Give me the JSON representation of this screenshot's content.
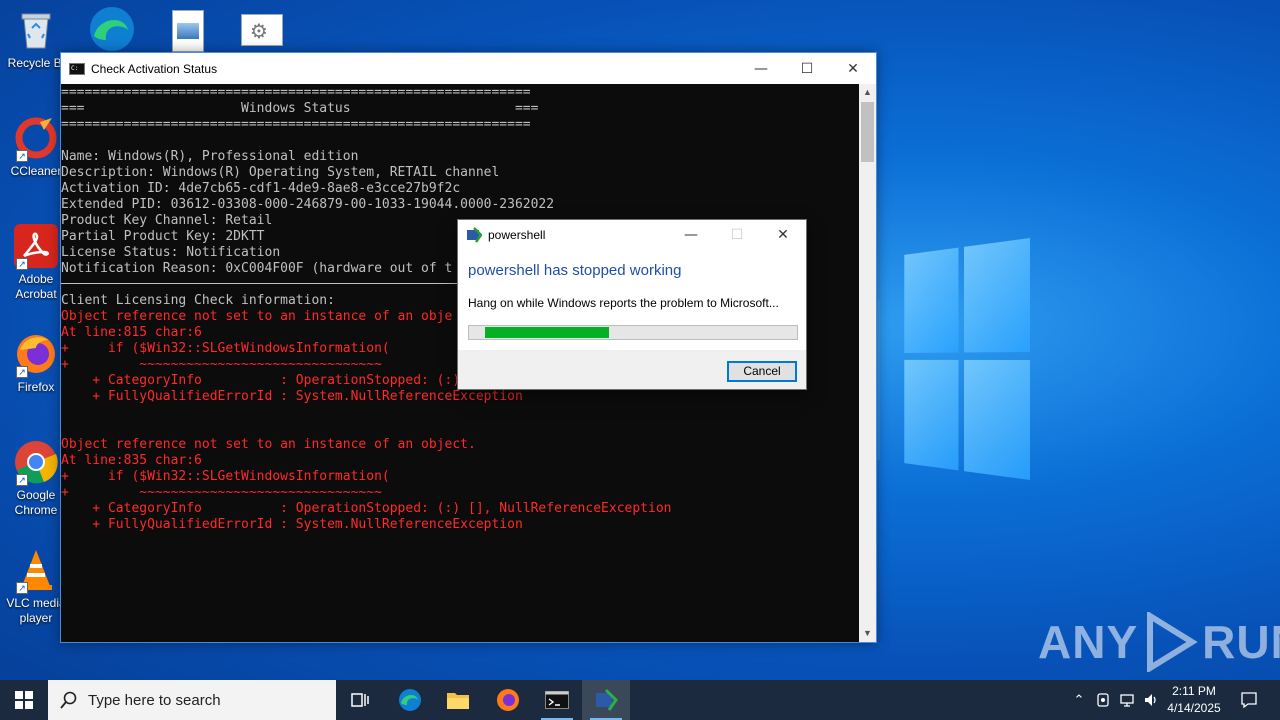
{
  "desktop": {
    "icons": [
      {
        "label": "Recycle Bi",
        "icon": "recycle-bin-icon"
      },
      {
        "label": "CCleaner",
        "icon": "ccleaner-icon"
      },
      {
        "label": "Adobe Acrobat",
        "icon": "adobe-acrobat-icon"
      },
      {
        "label": "Firefox",
        "icon": "firefox-icon"
      },
      {
        "label": "Google Chrome",
        "icon": "chrome-icon"
      },
      {
        "label": "VLC media player",
        "icon": "vlc-icon"
      }
    ],
    "top_icons": [
      "edge-icon",
      "image-file-icon",
      "settings-file-icon"
    ]
  },
  "console": {
    "title": "Check Activation Status",
    "lines": [
      {
        "text": "============================================================",
        "err": false
      },
      {
        "text": "===                    Windows Status                     ===",
        "err": false
      },
      {
        "text": "============================================================",
        "err": false
      },
      {
        "text": "",
        "err": false
      },
      {
        "text": "Name: Windows(R), Professional edition",
        "err": false
      },
      {
        "text": "Description: Windows(R) Operating System, RETAIL channel",
        "err": false
      },
      {
        "text": "Activation ID: 4de7cb65-cdf1-4de9-8ae8-e3cce27b9f2c",
        "err": false
      },
      {
        "text": "Extended PID: 03612-03308-000-246879-00-1033-19044.0000-2362022",
        "err": false
      },
      {
        "text": "Product Key Channel: Retail",
        "err": false
      },
      {
        "text": "Partial Product Key: 2DKTT",
        "err": false
      },
      {
        "text": "License Status: Notification",
        "err": false
      },
      {
        "text": "Notification Reason: 0xC004F00F (hardware out of t",
        "err": false
      },
      {
        "text": "",
        "err": false
      },
      {
        "text": "Client Licensing Check information:",
        "err": false
      },
      {
        "text": "Object reference not set to an instance of an obje",
        "err": true
      },
      {
        "text": "At line:815 char:6",
        "err": true
      },
      {
        "text": "+     if ($Win32::SLGetWindowsInformation(",
        "err": true
      },
      {
        "text": "+         ~~~~~~~~~~~~~~~~~~~~~~~~~~~~~~~",
        "err": true
      },
      {
        "text": "    + CategoryInfo          : OperationStopped: (:) [], NullReferenceException",
        "err": true
      },
      {
        "text": "    + FullyQualifiedErrorId : System.NullReferenceException",
        "err": true
      },
      {
        "text": "",
        "err": false
      },
      {
        "text": "",
        "err": false
      },
      {
        "text": "Object reference not set to an instance of an object.",
        "err": true
      },
      {
        "text": "At line:835 char:6",
        "err": true
      },
      {
        "text": "+     if ($Win32::SLGetWindowsInformation(",
        "err": true
      },
      {
        "text": "+         ~~~~~~~~~~~~~~~~~~~~~~~~~~~~~~~",
        "err": true
      },
      {
        "text": "    + CategoryInfo          : OperationStopped: (:) [], NullReferenceException",
        "err": true
      },
      {
        "text": "    + FullyQualifiedErrorId : System.NullReferenceException",
        "err": true
      }
    ]
  },
  "dialog": {
    "title": "powershell",
    "heading": "powershell has stopped working",
    "message": "Hang on while Windows reports the problem to Microsoft...",
    "progress_fraction": 0.42,
    "cancel_label": "Cancel"
  },
  "watermark": {
    "left": "ANY",
    "right": "RUN"
  },
  "taskbar": {
    "search_placeholder": "Type here to search",
    "apps": [
      "task-view-icon",
      "edge-icon",
      "file-explorer-icon",
      "firefox-icon",
      "console-icon",
      "powershell-error-icon"
    ],
    "time": "2:11 PM",
    "date": "4/14/2025"
  },
  "colors": {
    "console_bg": "#0c0c0c",
    "console_text": "#c0c0c0",
    "console_error": "#ff2a2a",
    "dialog_heading": "#1f4ea8",
    "progress_green": "#06b025",
    "taskbar_bg": "#1b2a3f"
  }
}
